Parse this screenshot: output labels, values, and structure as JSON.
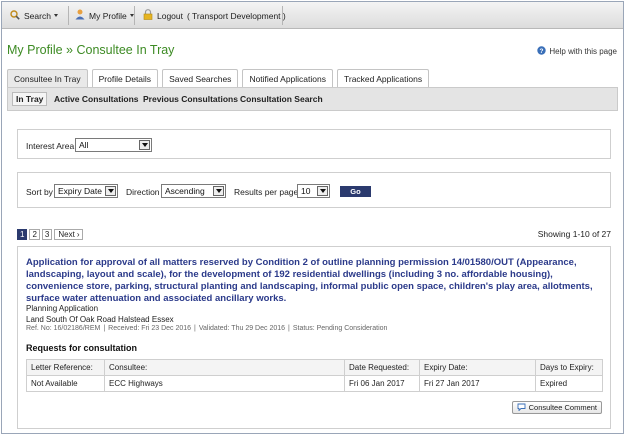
{
  "toolbar": {
    "search_label": "Search",
    "profile_label": "My Profile",
    "logout_label": "Logout",
    "logout_context": "( Transport Development )"
  },
  "page": {
    "title": "My Profile » Consultee In Tray",
    "help_label": "Help with this page"
  },
  "tabs": [
    {
      "label": "Consultee In Tray",
      "active": true
    },
    {
      "label": "Profile Details",
      "active": false
    },
    {
      "label": "Saved Searches",
      "active": false
    },
    {
      "label": "Notified Applications",
      "active": false
    },
    {
      "label": "Tracked Applications",
      "active": false
    }
  ],
  "subtabs": [
    {
      "label": "In Tray",
      "active": true
    },
    {
      "label": "Active Consultations",
      "active": false
    },
    {
      "label": "Previous Consultations",
      "active": false
    },
    {
      "label": "Consultation Search",
      "active": false
    }
  ],
  "filters": {
    "interest_area_label": "Interest Area",
    "interest_area_value": "All",
    "sort_by_label": "Sort by",
    "sort_by_value": "Expiry Date",
    "direction_label": "Direction",
    "direction_value": "Ascending",
    "results_per_page_label": "Results per page",
    "results_per_page_value": "10",
    "go_label": "Go"
  },
  "pagination": {
    "pages": [
      "1",
      "2",
      "3"
    ],
    "next_label": "Next",
    "showing": "Showing 1-10 of 27"
  },
  "application": {
    "title": "Application for approval of all matters reserved by Condition 2 of outline planning permission 14/01580/OUT (Appearance, landscaping, layout and scale), for the development of 192 residential dwellings (including 3 no. affordable housing), convenience store, parking, structural planting and landscaping, informal public open space, children's play area, allotments, surface water attenuation and associated ancillary works.",
    "type": "Planning Application",
    "address": "Land South Of Oak Road Halstead Essex",
    "ref": "Ref. No: 16/02186/REM",
    "received": "Received: Fri 23 Dec 2016",
    "validated": "Validated: Thu 29 Dec 2016",
    "status": "Status: Pending Consideration",
    "requests_heading": "Requests for consultation",
    "table_headers": [
      "Letter Reference:",
      "Consultee:",
      "Date Requested:",
      "Expiry Date:",
      "Days to Expiry:"
    ],
    "rows": [
      [
        "Not Available",
        "ECC Highways",
        "Fri 06 Jan 2017",
        "Fri 27 Jan 2017",
        "Expired"
      ]
    ],
    "comment_button": "Consultee Comment"
  },
  "colors": {
    "title_green": "#3d8b24",
    "link_blue": "#2b3a8a",
    "button_navy": "#2b3a6e"
  }
}
